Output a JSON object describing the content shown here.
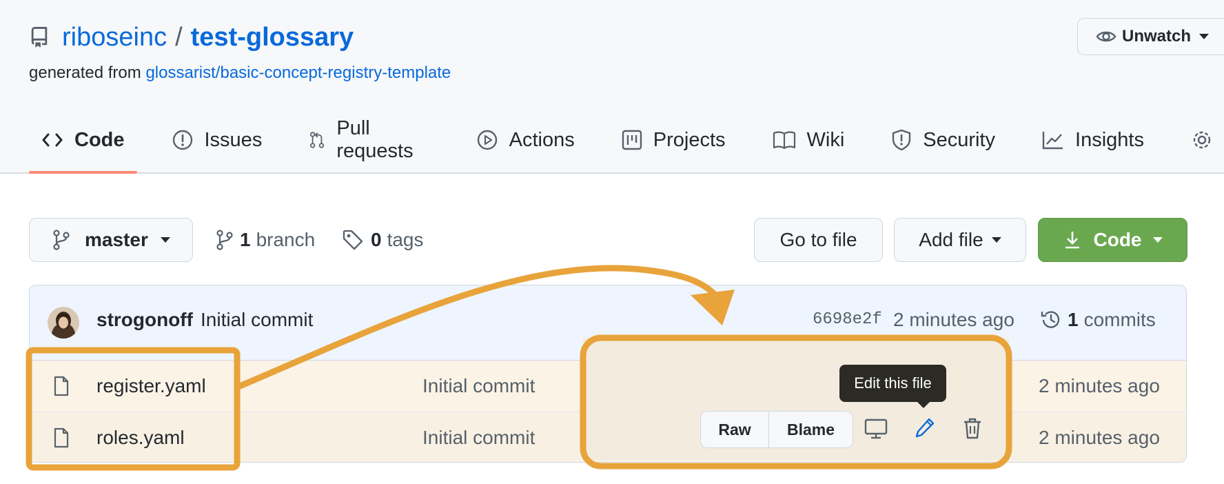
{
  "repo": {
    "owner": "riboseinc",
    "separator": "/",
    "name": "test-glossary",
    "generated_prefix": "generated from",
    "generated_link": "glossarist/basic-concept-registry-template",
    "unwatch_label": "Unwatch"
  },
  "tabs": [
    {
      "label": "Code",
      "icon": "code-icon"
    },
    {
      "label": "Issues",
      "icon": "issue-icon"
    },
    {
      "label": "Pull requests",
      "icon": "pull-request-icon"
    },
    {
      "label": "Actions",
      "icon": "play-icon"
    },
    {
      "label": "Projects",
      "icon": "project-icon"
    },
    {
      "label": "Wiki",
      "icon": "book-icon"
    },
    {
      "label": "Security",
      "icon": "shield-icon"
    },
    {
      "label": "Insights",
      "icon": "graph-icon"
    }
  ],
  "toolbar": {
    "branch_name": "master",
    "branch_count": "1",
    "branch_word": "branch",
    "tag_count": "0",
    "tag_word": "tags",
    "go_to_file": "Go to file",
    "add_file": "Add file",
    "code_button": "Code"
  },
  "commit": {
    "author": "strogonoff",
    "message": "Initial commit",
    "hash": "6698e2f",
    "time": "2 minutes ago",
    "commit_count": "1",
    "commit_word": "commits"
  },
  "files": [
    {
      "name": "register.yaml",
      "message": "Initial commit",
      "time": "2 minutes ago"
    },
    {
      "name": "roles.yaml",
      "message": "Initial commit",
      "time": "2 minutes ago"
    }
  ],
  "file_actions": {
    "raw": "Raw",
    "blame": "Blame",
    "tooltip": "Edit this file"
  },
  "colors": {
    "link": "#0969da",
    "accent_underline": "#fd8c73",
    "code_button": "#6aa84f",
    "annotation": "#e8a33b"
  }
}
